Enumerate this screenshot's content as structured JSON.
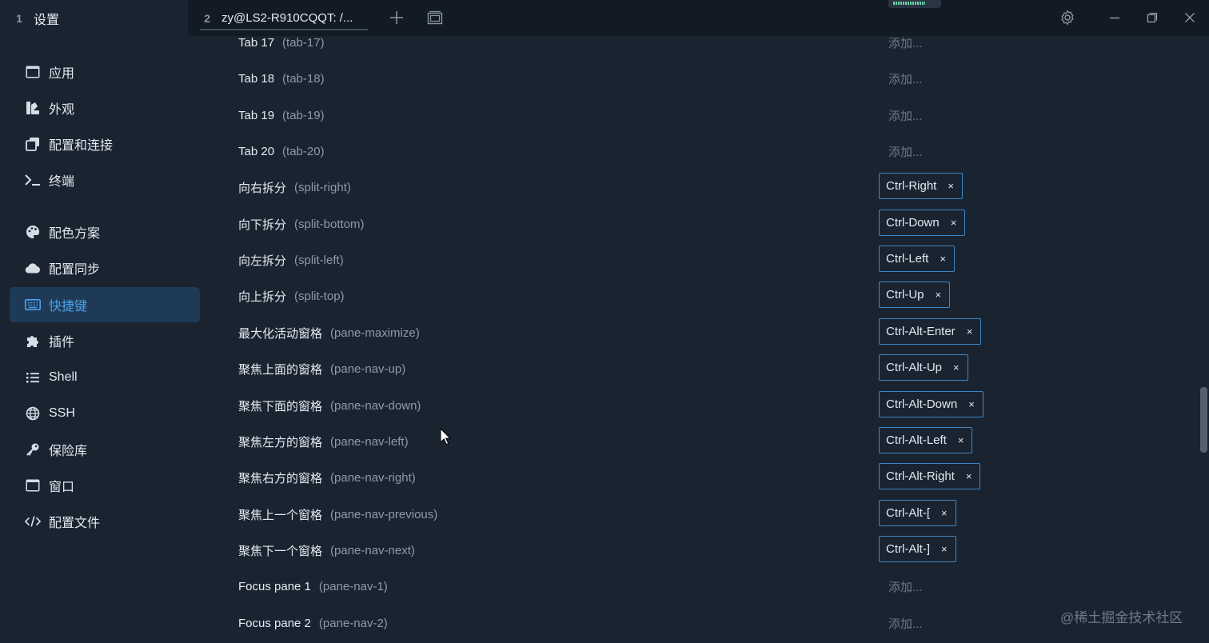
{
  "tabs": [
    {
      "number": "1",
      "title": "设置"
    },
    {
      "number": "2",
      "title": "zy@LS2-R910CQQT: /..."
    }
  ],
  "toolbar_icons": [
    "add-tab-icon",
    "tab-overview-icon",
    "settings-gear-icon",
    "minimize-icon",
    "restore-icon",
    "close-icon"
  ],
  "sidebar": {
    "items": [
      {
        "label": "应用",
        "icon": "application-window-icon"
      },
      {
        "label": "外观",
        "icon": "appearance-palette-icon"
      },
      {
        "label": "配置和连接",
        "icon": "profiles-icon"
      },
      {
        "label": "终端",
        "icon": "terminal-prompt-icon"
      },
      {
        "label": "配色方案",
        "icon": "color-palette-icon"
      },
      {
        "label": "配置同步",
        "icon": "cloud-icon"
      },
      {
        "label": "快捷键",
        "icon": "keyboard-icon",
        "active": true
      },
      {
        "label": "插件",
        "icon": "puzzle-icon"
      },
      {
        "label": "Shell",
        "icon": "list-icon"
      },
      {
        "label": "SSH",
        "icon": "globe-icon"
      },
      {
        "label": "保险库",
        "icon": "key-icon"
      },
      {
        "label": "窗口",
        "icon": "window-icon"
      },
      {
        "label": "配置文件",
        "icon": "code-icon"
      }
    ]
  },
  "hotkeys": {
    "add_label": "添加...",
    "rows": [
      {
        "title": "Tab 17",
        "id": "(tab-17)",
        "keys": []
      },
      {
        "title": "Tab 18",
        "id": "(tab-18)",
        "keys": []
      },
      {
        "title": "Tab 19",
        "id": "(tab-19)",
        "keys": []
      },
      {
        "title": "Tab 20",
        "id": "(tab-20)",
        "keys": []
      },
      {
        "title": "向右拆分",
        "id": "(split-right)",
        "keys": [
          "Ctrl-Right"
        ]
      },
      {
        "title": "向下拆分",
        "id": "(split-bottom)",
        "keys": [
          "Ctrl-Down"
        ]
      },
      {
        "title": "向左拆分",
        "id": "(split-left)",
        "keys": [
          "Ctrl-Left"
        ]
      },
      {
        "title": "向上拆分",
        "id": "(split-top)",
        "keys": [
          "Ctrl-Up"
        ]
      },
      {
        "title": "最大化活动窗格",
        "id": "(pane-maximize)",
        "keys": [
          "Ctrl-Alt-Enter"
        ]
      },
      {
        "title": "聚焦上面的窗格",
        "id": "(pane-nav-up)",
        "keys": [
          "Ctrl-Alt-Up"
        ]
      },
      {
        "title": "聚焦下面的窗格",
        "id": "(pane-nav-down)",
        "keys": [
          "Ctrl-Alt-Down"
        ]
      },
      {
        "title": "聚焦左方的窗格",
        "id": "(pane-nav-left)",
        "keys": [
          "Ctrl-Alt-Left"
        ]
      },
      {
        "title": "聚焦右方的窗格",
        "id": "(pane-nav-right)",
        "keys": [
          "Ctrl-Alt-Right"
        ]
      },
      {
        "title": "聚焦上一个窗格",
        "id": "(pane-nav-previous)",
        "keys": [
          "Ctrl-Alt-["
        ]
      },
      {
        "title": "聚焦下一个窗格",
        "id": "(pane-nav-next)",
        "keys": [
          "Ctrl-Alt-]"
        ]
      },
      {
        "title": "Focus pane 1",
        "id": "(pane-nav-1)",
        "keys": []
      },
      {
        "title": "Focus pane 2",
        "id": "(pane-nav-2)",
        "keys": []
      }
    ]
  },
  "chip_remove_glyph": "×",
  "watermark": "@稀土掘金技术社区",
  "colors": {
    "accent": "#4aa3ea",
    "chip_border": "#3f86c4",
    "background": "#1a2431",
    "titlebar": "#121a24"
  }
}
